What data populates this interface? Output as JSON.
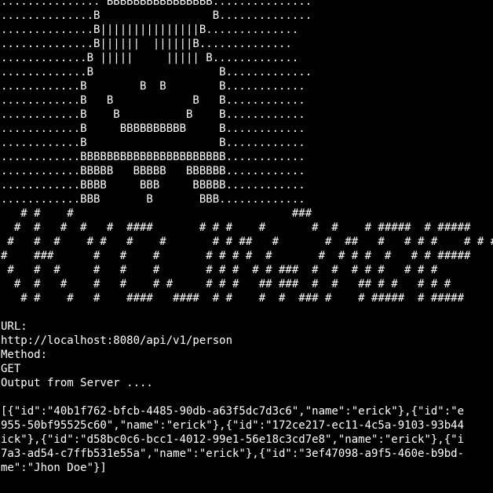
{
  "colors": {
    "background": "#000000",
    "foreground": "#ffffff"
  },
  "terminal": {
    "art_top": [
      "............... BBBBBBBBBBBBBBBB...............",
      "..............B                 B..............",
      "..............B|||||||||||||||B..............",
      "..............B||||||  ||||||B..............",
      ".............B |||||     ||||| B.............",
      ".............B                   B.............",
      "............B        B  B        B............",
      "............B   B            B   B............",
      "............B    B          B    B............",
      "............B     BBBBBBBBBB     B............",
      "............B                    B............",
      "............BBBBBBBBBBBBBBBBBBBBBB............",
      "............BBBBB   BBBBB   BBBBBB............",
      "............BBBB     BBB     BBBBB............",
      "............BBB       B       BBB............."
    ],
    "art_banner": [
      "   # #    #                                 ###",
      "  #  #   #  #   #  ####       # # #    #       #  #    # #####  # #####",
      " #   #  #    # #   #    #       # # ##   #       #  ##   #   # # #    # # #",
      "#    ###      #   #    #       # # # #  #       #  # # #  #   # # #####",
      " #   #  #     #   #    #       # # #  # # ###  #  #  # # #   # # #",
      "  #  #   #    #   #    # #     # # #   ## ###  #  #   ## # #   # # #",
      "   # #    #   #    ####   ####  # #    #  #  ### #    # #####  # #####"
    ],
    "output": {
      "url_label": "URL:",
      "url_value": "http://localhost:8080/api/v1/person",
      "method_label": "Method:",
      "method_value": "GET",
      "server_output_label": "Output from Server ....",
      "json_lines": [
        "[{\"id\":\"40b1f762-bfcb-4485-90db-a63f5dc7d3c6\",\"name\":\"erick\"},{\"id\":\"e",
        "955-50bf95525c60\",\"name\":\"erick\"},{\"id\":\"172ce217-ec11-4c5a-9103-93b44",
        "ick\"},{\"id\":\"d58bc0c6-bcc1-4012-99e1-56e18c3cd7e8\",\"name\":\"erick\"},{\"i",
        "7a3-ad54-c7ffb531e55a\",\"name\":\"erick\"},{\"id\":\"3ef47098-a9f5-460e-b9bd-",
        "me\":\"Jhon Doe\"}]"
      ]
    }
  }
}
